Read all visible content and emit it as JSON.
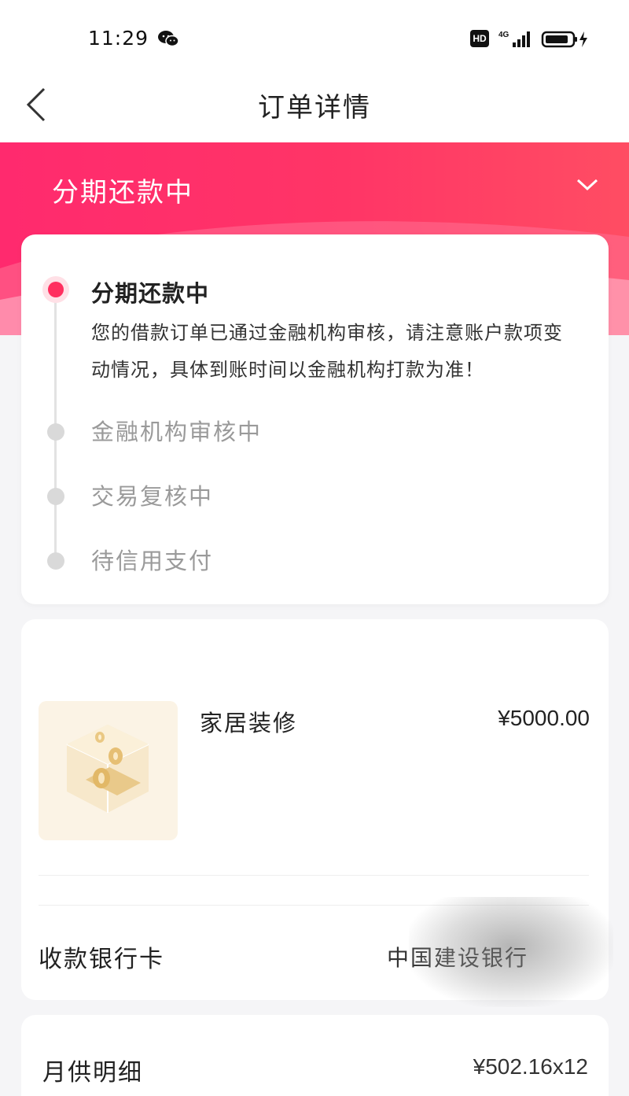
{
  "status_bar": {
    "time": "11:29",
    "hd_badge": "HD",
    "network": "4G",
    "icons": [
      "wechat-icon",
      "hd-icon",
      "signal-icon",
      "battery-charging-icon"
    ]
  },
  "nav": {
    "title": "订单详情",
    "back_icon": "chevron-left-icon"
  },
  "header": {
    "status": "分期还款中",
    "toggle_icon": "chevron-down-icon",
    "accent": "#ff2f5f"
  },
  "progress": {
    "active_title": "分期还款中",
    "active_desc": "您的借款订单已通过金融机构审核，请注意账户款项变动情况，具体到账时间以金融机构打款为准！",
    "steps": [
      {
        "label": "金融机构审核中"
      },
      {
        "label": "交易复核中"
      },
      {
        "label": "待信用支付"
      }
    ]
  },
  "order": {
    "product_name": "家居装修",
    "product_price": "¥5000.00",
    "product_icon": "coin-box-icon",
    "bank_label": "收款银行卡",
    "bank_value": "中国建设银行"
  },
  "detail": {
    "label": "月供明细",
    "value": "¥502.16x12"
  }
}
